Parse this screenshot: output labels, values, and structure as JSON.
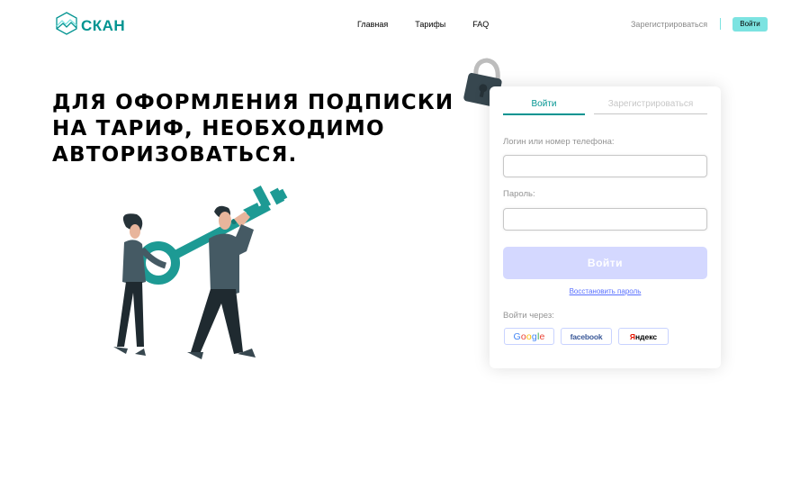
{
  "header": {
    "logo_text": "СКАН",
    "nav": [
      "Главная",
      "Тарифы",
      "FAQ"
    ],
    "register_label": "Зарегистрироваться",
    "login_button": "Войти"
  },
  "headline": {
    "lines": [
      "ДЛЯ ОФОРМЛЕНИЯ ПОДПИСКИ",
      "НА ТАРИФ, НЕОБХОДИМО",
      "АВТОРИЗОВАТЬСЯ."
    ]
  },
  "login_form": {
    "tabs": [
      "Войти",
      "Зарегистрироваться"
    ],
    "active_tab": 0,
    "login_label": "Логин или номер телефона:",
    "login_value": "",
    "password_label": "Пароль:",
    "password_value": "",
    "submit_label": "Войти",
    "restore_link": "Восстановить пароль",
    "via_label": "Войти через:",
    "social": {
      "google": [
        "G",
        "o",
        "o",
        "g",
        "l",
        "e"
      ],
      "facebook": "facebook",
      "yandex_first": "Я",
      "yandex_rest": "ндекс"
    }
  },
  "colors": {
    "brand": "#029491",
    "accent": "#7CE3E1",
    "submit_disabled": "#D4D8FF",
    "link": "#5970FF"
  }
}
